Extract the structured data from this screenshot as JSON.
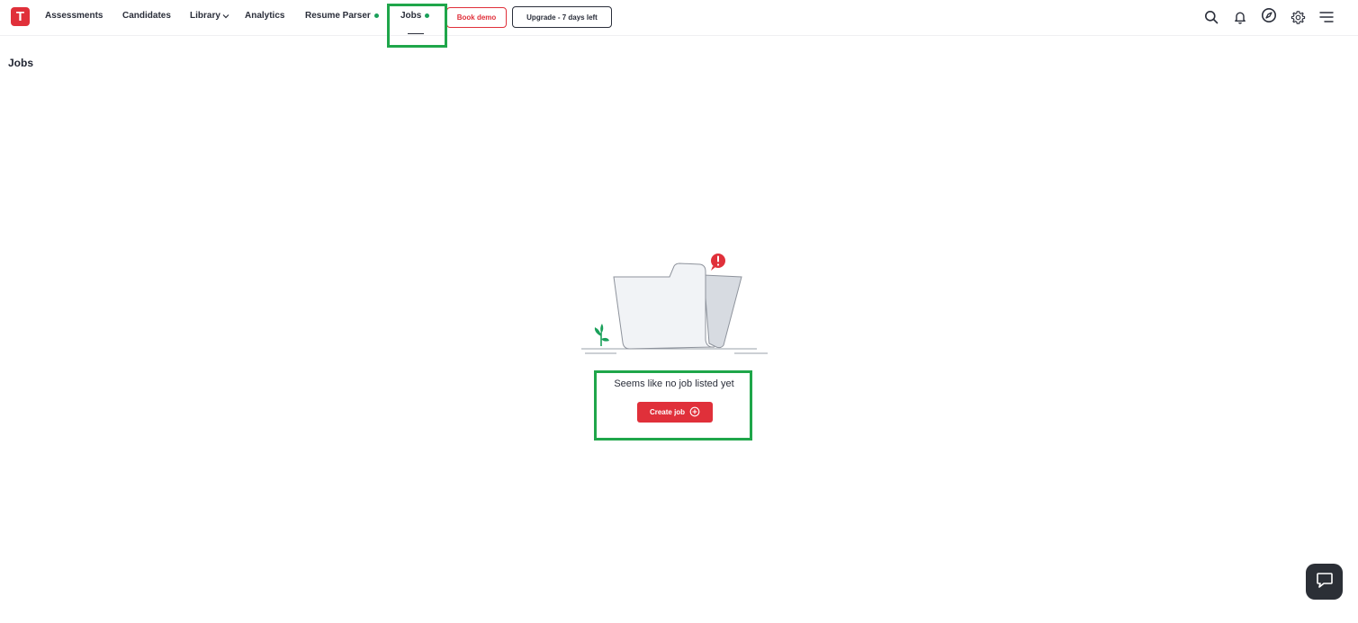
{
  "logo": {
    "letter": "T"
  },
  "nav": {
    "assessments": "Assessments",
    "candidates": "Candidates",
    "library": "Library",
    "analytics": "Analytics",
    "resume_parser": "Resume Parser",
    "jobs": "Jobs"
  },
  "buttons": {
    "book_demo": "Book demo",
    "upgrade": "Upgrade - 7 days left"
  },
  "icons": [
    "search-icon",
    "bell-icon",
    "compass-icon",
    "gear-icon",
    "menu-icon"
  ],
  "page": {
    "title": "Jobs"
  },
  "empty_state": {
    "message": "Seems like no job listed yet",
    "create_label": "Create job"
  },
  "colors": {
    "brand_red": "#e0303a",
    "status_green": "#1aa05a",
    "highlight_green": "#1fa64a",
    "help_dark": "#2b2f36"
  }
}
